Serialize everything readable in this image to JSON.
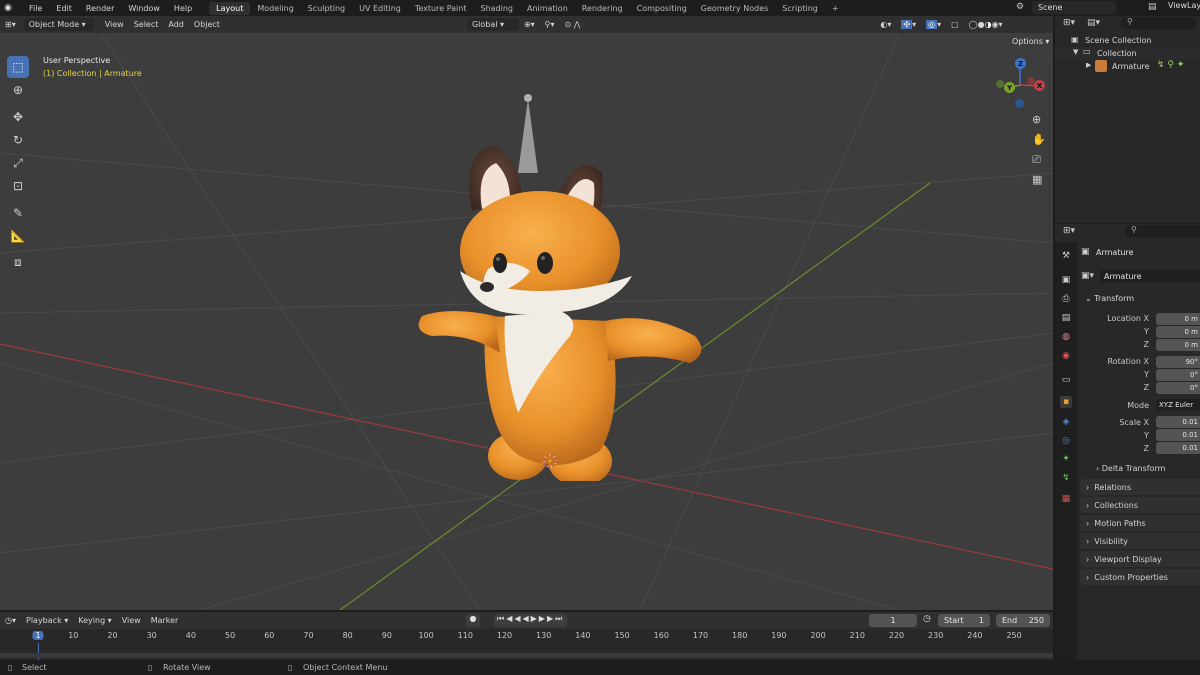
{
  "menu": [
    "File",
    "Edit",
    "Render",
    "Window",
    "Help"
  ],
  "workspaces": [
    "Layout",
    "Modeling",
    "Sculpting",
    "UV Editing",
    "Texture Paint",
    "Shading",
    "Animation",
    "Rendering",
    "Compositing",
    "Geometry Nodes",
    "Scripting"
  ],
  "active_workspace": "Layout",
  "add_tab": "+",
  "scene": "Scene",
  "view_layer": "ViewLayer",
  "viewport_header": {
    "mode": "Object Mode",
    "menus": [
      "View",
      "Select",
      "Add",
      "Object"
    ],
    "orientation": "Global",
    "options": "Options"
  },
  "viewport": {
    "perspective": "User Perspective",
    "collection_prefix": "(1) Collection | ",
    "active_object": "Armature",
    "gizmo": {
      "x": "X",
      "y": "Y",
      "z": "Z"
    }
  },
  "outliner": {
    "scene_collection": "Scene Collection",
    "collection": "Collection",
    "object": "Armature"
  },
  "properties": {
    "object_name": "Armature",
    "data_name": "Armature",
    "transform_label": "Transform",
    "location": {
      "label_x": "Location X",
      "label_y": "Y",
      "label_z": "Z",
      "x": "0 m",
      "y": "0 m",
      "z": "0 m"
    },
    "rotation": {
      "label_x": "Rotation X",
      "label_y": "Y",
      "label_z": "Z",
      "x": "90°",
      "y": "0°",
      "z": "0°"
    },
    "mode_label": "Mode",
    "mode_value": "XYZ Euler",
    "scale": {
      "label_x": "Scale X",
      "label_y": "Y",
      "label_z": "Z",
      "x": "0.01",
      "y": "0.01",
      "z": "0.01"
    },
    "delta_transform": "Delta Transform",
    "panels": [
      "Relations",
      "Collections",
      "Motion Paths",
      "Visibility",
      "Viewport Display",
      "Custom Properties"
    ]
  },
  "timeline": {
    "menus": [
      "Playback",
      "Keying",
      "View",
      "Marker"
    ],
    "current_frame": "1",
    "start_label": "Start",
    "start": "1",
    "end_label": "End",
    "end": "250",
    "ticks": [
      "1",
      "10",
      "20",
      "30",
      "40",
      "50",
      "60",
      "70",
      "80",
      "90",
      "100",
      "110",
      "120",
      "130",
      "140",
      "150",
      "160",
      "170",
      "180",
      "190",
      "200",
      "210",
      "220",
      "230",
      "240",
      "250"
    ]
  },
  "status": {
    "select": "Select",
    "rotate": "Rotate View",
    "context": "Object Context Menu"
  },
  "colors": {
    "accent": "#4772b3",
    "x_axis": "#c13f48",
    "y_axis": "#7aa32a",
    "z_axis": "#3c74c6",
    "active_label": "#e3d24a"
  }
}
